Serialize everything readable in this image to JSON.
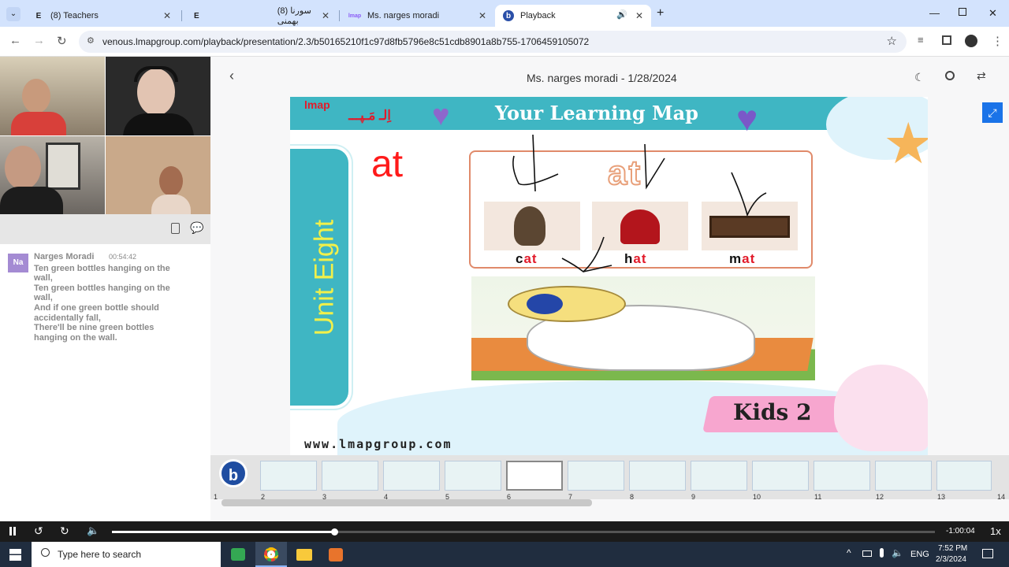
{
  "browser": {
    "tabs": [
      {
        "title": "(8) Teachers",
        "icon": "E"
      },
      {
        "title": "(8) سورنا بهمنی",
        "icon": "E"
      },
      {
        "title": "Ms. narges moradi",
        "icon": "lmap"
      },
      {
        "title": "Playback",
        "icon": "b"
      }
    ],
    "url": "venous.lmapgroup.com/playback/presentation/2.3/b50165210f1c97d8fb5796e8c51cdb8901a8b755-1706459105072"
  },
  "chat": {
    "avatar": "Na",
    "sender": "Narges Moradi",
    "time": "00:54:42",
    "lines": [
      "Ten green bottles hanging on the",
      "wall,",
      "Ten green bottles hanging on the",
      "wall,",
      "And if one green bottle should",
      "accidentally fall,",
      "There'll be nine green bottles",
      "hanging on the wall."
    ]
  },
  "playback": {
    "title": "Ms. narges moradi - 1/28/2024",
    "remaining": "-1:00:04",
    "speed": "1x",
    "progress": 0.27
  },
  "slide": {
    "logo_latin": "lmap",
    "logo_farsi": "اِلـ مَـپـــ",
    "banner": "Your Learning Map",
    "unit": "Unit Eight",
    "topic": "at",
    "family": "at",
    "words": [
      {
        "first": "c",
        "rest": "at"
      },
      {
        "first": "h",
        "rest": "at"
      },
      {
        "first": "m",
        "rest": "at"
      }
    ],
    "footer": "www.lmapgroup.com",
    "level": "Kids 2"
  },
  "thumbnails": [
    "1",
    "2",
    "3",
    "4",
    "5",
    "6",
    "7",
    "8",
    "9",
    "10",
    "11",
    "12",
    "13",
    "14"
  ],
  "taskbar": {
    "search_placeholder": "Type here to search",
    "lang": "ENG",
    "time": "7:52 PM",
    "date": "2/3/2024"
  },
  "colors": {
    "accent": "#1a73e8",
    "slide_teal": "#3fb6c3",
    "unit_yellow": "#f1f04a",
    "topic_red": "#ff1a1a",
    "banner_pink": "#f7a6cf"
  }
}
